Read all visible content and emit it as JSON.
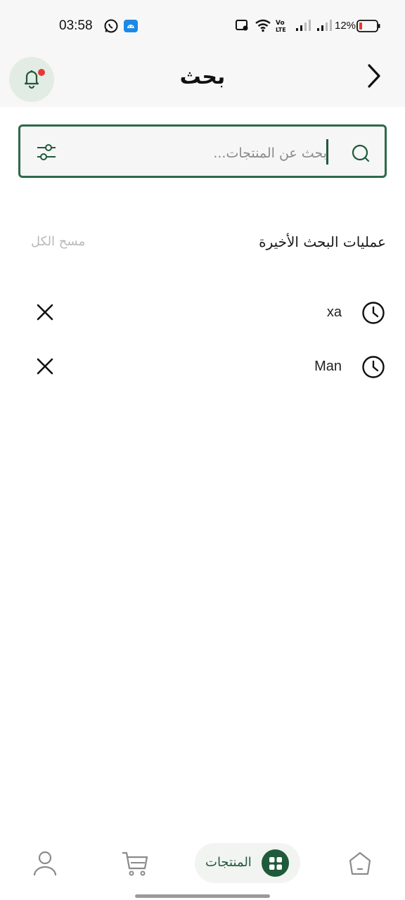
{
  "status_bar": {
    "time": "03:58",
    "battery": "12%",
    "icons": [
      "whatsapp-icon",
      "android-icon",
      "image-icon",
      "wifi-icon",
      "volte-icon",
      "signal-icon",
      "signal-icon",
      "battery-icon"
    ]
  },
  "header": {
    "title": "بحث"
  },
  "search": {
    "placeholder": "بحث عن المنتجات..."
  },
  "recent": {
    "title": "عمليات البحث الأخيرة",
    "clear_all": "مسح الكل",
    "items": [
      {
        "term": "xa"
      },
      {
        "term": "Man"
      }
    ]
  },
  "bottom_nav": {
    "products_label": "المنتجات",
    "items": [
      "profile-icon",
      "cart-icon",
      "products-icon",
      "home-icon"
    ]
  },
  "colors": {
    "accent": "#1f5a3a",
    "notification": "#e53935",
    "muted": "#b9b9b9"
  }
}
